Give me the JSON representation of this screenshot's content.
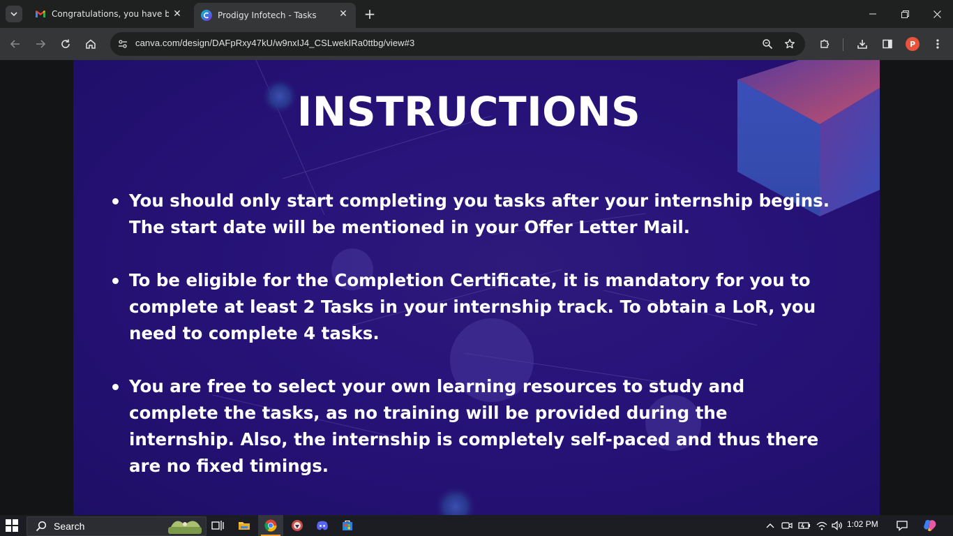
{
  "browser": {
    "tabs": [
      {
        "title": "Congratulations, you have been",
        "favicon": "gmail-icon",
        "active": false
      },
      {
        "title": "Prodigy Infotech - Tasks",
        "favicon": "canva-icon",
        "active": true
      }
    ],
    "address_bar": {
      "url": "canva.com/design/DAFpRxy47kU/w9nxIJ4_CSLwekIRa0ttbg/view#3"
    },
    "profile_initial": "P"
  },
  "slide": {
    "title": "INSTRUCTIONS",
    "bullets": [
      "You should only start completing you tasks after your internship begins. The start date will be mentioned in your Offer Letter Mail.",
      "To be eligible for the Completion Certificate, it is mandatory for you to complete at least 2 Tasks in your internship track. To obtain a LoR, you need to complete 4 tasks.",
      "You are free to select your own learning resources to study and complete the tasks, as no training will be provided during the internship. Also, the internship is completely self-paced and thus there are no fixed timings."
    ],
    "colors": {
      "background": "#28147a",
      "text": "#ffffff"
    }
  },
  "taskbar": {
    "search_placeholder": "Search",
    "clock": "1:02 PM"
  }
}
